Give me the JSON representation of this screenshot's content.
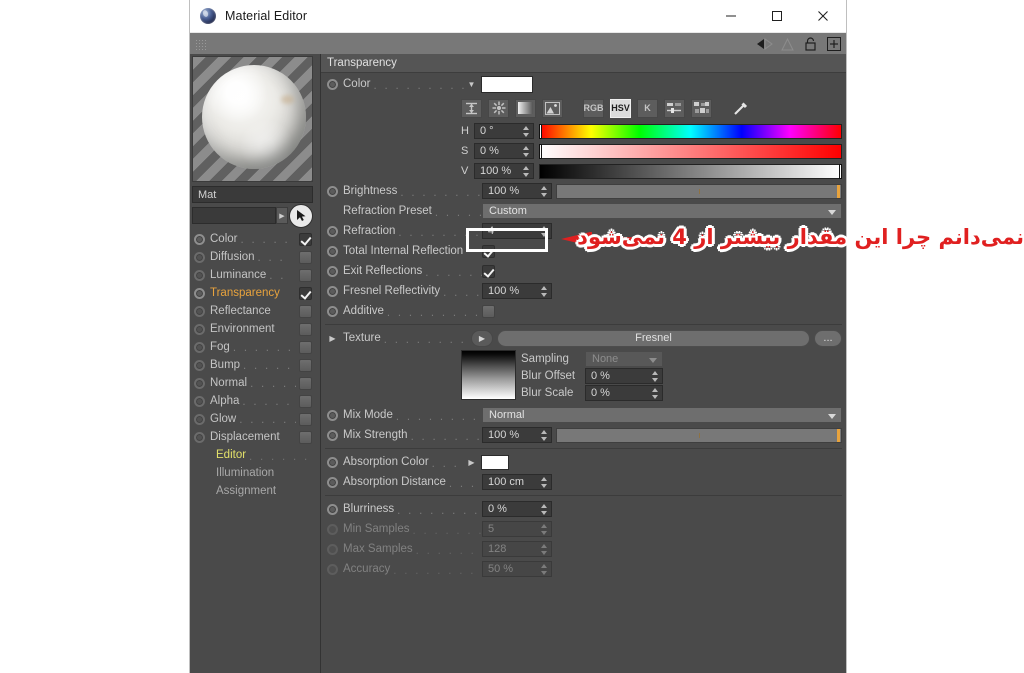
{
  "window": {
    "title": "Material Editor",
    "minimize": "minimize-icon",
    "maximize": "maximize-icon",
    "close": "close-icon"
  },
  "toolbar": {
    "icons": [
      "back-arrow-icon",
      "forward-arrow-icon",
      "up-triangle-icon",
      "lock-icon",
      "add-box-icon"
    ]
  },
  "preview": {
    "material_name": "Mat"
  },
  "sidebar": {
    "channels": [
      {
        "label": "Color",
        "dots": ". . . . . .",
        "checked": true,
        "active": false
      },
      {
        "label": "Diffusion",
        "dots": ". . .",
        "checked": false,
        "active": false
      },
      {
        "label": "Luminance",
        "dots": ". .",
        "checked": false,
        "active": false
      },
      {
        "label": "Transparency",
        "dots": "",
        "checked": true,
        "active": true
      },
      {
        "label": "Reflectance",
        "dots": "",
        "checked": false,
        "active": false
      },
      {
        "label": "Environment",
        "dots": "",
        "checked": false,
        "active": false
      },
      {
        "label": "Fog",
        "dots": ". . . . . . . .",
        "checked": false,
        "active": false
      },
      {
        "label": "Bump",
        "dots": ". . . . . .",
        "checked": false,
        "active": false
      },
      {
        "label": "Normal",
        "dots": ". . . . .",
        "checked": false,
        "active": false
      },
      {
        "label": "Alpha",
        "dots": ". . . . . .",
        "checked": false,
        "active": false
      },
      {
        "label": "Glow",
        "dots": ". . . . . . .",
        "checked": false,
        "active": false
      },
      {
        "label": "Displacement",
        "dots": "",
        "checked": false,
        "active": false
      }
    ],
    "subitems": [
      {
        "label": "Editor",
        "dots": ". . . . . .",
        "highlight": true
      },
      {
        "label": "Illumination",
        "dots": "",
        "highlight": false
      },
      {
        "label": "Assignment",
        "dots": "",
        "highlight": false
      }
    ]
  },
  "panel": {
    "header": "Transparency",
    "color": {
      "label": "Color",
      "dots": ". . . . . . . . . . . .",
      "swatch_hex": "#ffffff",
      "tools": [
        {
          "name": "expand-icon",
          "label": "",
          "active": false
        },
        {
          "name": "color-wheel-icon",
          "label": "",
          "active": false
        },
        {
          "name": "gradient-icon",
          "label": "",
          "active": false
        },
        {
          "name": "image-icon",
          "label": "",
          "active": false
        },
        {
          "name": "rgb-mode-button",
          "label": "RGB",
          "active": false
        },
        {
          "name": "hsv-mode-button",
          "label": "HSV",
          "active": true
        },
        {
          "name": "k-mode-button",
          "label": "K",
          "active": false
        },
        {
          "name": "sliders-icon",
          "label": "",
          "active": false
        },
        {
          "name": "swatches-icon",
          "label": "",
          "active": false
        },
        {
          "name": "eyedropper-icon",
          "label": "",
          "active": false
        }
      ],
      "hsv": [
        {
          "label": "H",
          "value": "0 °",
          "handle_pct": 0
        },
        {
          "label": "S",
          "value": "0 %",
          "handle_pct": 0
        },
        {
          "label": "V",
          "value": "100 %",
          "handle_pct": 100
        }
      ]
    },
    "brightness": {
      "label": "Brightness",
      "dots": ". . . . . . . . . .",
      "value": "100 %"
    },
    "refraction_preset": {
      "label": "Refraction Preset",
      "dots": ". . . . . .",
      "value": "Custom"
    },
    "refraction": {
      "label": "Refraction",
      "dots": ". . . . . . . . . .",
      "value": "4",
      "highlighted": true
    },
    "total_internal": {
      "label": "Total Internal Reflection",
      "dots": "",
      "checked": true
    },
    "exit_reflections": {
      "label": "Exit Reflections",
      "dots": ". . . . . . .",
      "checked": true
    },
    "fresnel_reflect": {
      "label": "Fresnel Reflectivity",
      "dots": ". . . .",
      "value": "100 %"
    },
    "additive": {
      "label": "Additive",
      "dots": ". . . . . . . . . . .",
      "checked": false
    },
    "texture": {
      "label": "Texture",
      "dots": ". . . . . . . . . . . .",
      "value": "Fresnel",
      "more_label": "...",
      "sampling_label": "Sampling",
      "sampling_value": "None",
      "blur_offset_label": "Blur Offset",
      "blur_offset_value": "0 %",
      "blur_scale_label": "Blur Scale",
      "blur_scale_value": "0 %"
    },
    "mix_mode": {
      "label": "Mix Mode",
      "dots": ". . . . . . . . . . .",
      "value": "Normal"
    },
    "mix_strength": {
      "label": "Mix Strength",
      "dots": ". . . . . . . . .",
      "value": "100 %"
    },
    "absorption_color": {
      "label": "Absorption Color",
      "dots": ". . .",
      "swatch_hex": "#ffffff"
    },
    "absorption_distance": {
      "label": "Absorption Distance",
      "dots": ". . .",
      "value": "100 cm"
    },
    "blurriness": {
      "label": "Blurriness",
      "dots": ". . . . . . . . . . .",
      "value": "0 %",
      "enabled": true
    },
    "min_samples": {
      "label": "Min Samples",
      "dots": ". . . . . . . . .",
      "value": "5",
      "enabled": false
    },
    "max_samples": {
      "label": "Max Samples",
      "dots": ". . . . . . . . .",
      "value": "128",
      "enabled": false
    },
    "accuracy": {
      "label": "Accuracy",
      "dots": ". . . . . . . . . . .",
      "value": "50 %",
      "enabled": false
    }
  },
  "annotation": {
    "text": "نمی‌دانم چرا این مقدار بیشتر از 4 نمی‌شود",
    "color": "#e02020",
    "arrow": "left-arrow"
  }
}
